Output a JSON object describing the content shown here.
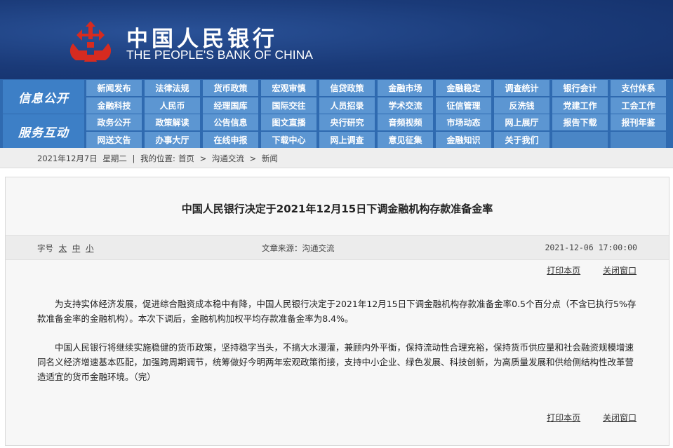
{
  "header": {
    "cn_name": "中国人民银行",
    "en_name": "THE PEOPLE'S BANK OF CHINA",
    "logo_icon": "pboc-emblem-icon",
    "colors": {
      "header_bg": "#1c3d7d",
      "logo_red": "#d62b20"
    }
  },
  "nav": {
    "groups": [
      {
        "title": "信息公开",
        "rows": [
          [
            "新闻发布",
            "法律法规",
            "货币政策",
            "宏观审慎",
            "信贷政策",
            "金融市场",
            "金融稳定",
            "调查统计",
            "银行会计",
            "支付体系"
          ],
          [
            "金融科技",
            "人民币",
            "经理国库",
            "国际交往",
            "人员招录",
            "学术交流",
            "征信管理",
            "反洗钱",
            "党建工作",
            "工会工作"
          ]
        ]
      },
      {
        "title": "服务互动",
        "rows": [
          [
            "政务公开",
            "政策解读",
            "公告信息",
            "图文直播",
            "央行研究",
            "音频视频",
            "市场动态",
            "网上展厅",
            "报告下载",
            "报刊年鉴"
          ],
          [
            "网送文告",
            "办事大厅",
            "在线申报",
            "下载中心",
            "网上调查",
            "意见征集",
            "金融知识",
            "关于我们",
            "",
            ""
          ]
        ]
      }
    ],
    "colors": {
      "nav_bg": "#2f6ab0",
      "cell_bg": "#5c96d2"
    }
  },
  "breadcrumb": {
    "date": "2021年12月7日",
    "weekday": "星期二",
    "sep": "|",
    "location_label": "我的位置:",
    "items": [
      "首页",
      "沟通交流",
      "新闻"
    ],
    "arrow": ">"
  },
  "article": {
    "title": "中国人民银行决定于2021年12月15日下调金融机构存款准备金率",
    "font_size_label": "字号",
    "font_sizes": [
      "太",
      "中",
      "小"
    ],
    "source": "文章来源：沟通交流",
    "datetime": "2021-12-06 17:00:00",
    "print_label": "打印本页",
    "close_label": "关闭窗口",
    "paragraphs": [
      "为支持实体经济发展，促进综合融资成本稳中有降，中国人民银行决定于2021年12月15日下调金融机构存款准备金率0.5个百分点（不含已执行5%存款准备金率的金融机构）。本次下调后，金融机构加权平均存款准备金率为8.4%。",
      "中国人民银行将继续实施稳健的货币政策，坚持稳字当头，不搞大水漫灌，兼顾内外平衡，保持流动性合理充裕，保持货币供应量和社会融资规模增速同名义经济增速基本匹配，加强跨周期调节，统筹做好今明两年宏观政策衔接，支持中小企业、绿色发展、科技创新，为高质量发展和供给侧结构性改革营造适宜的货币金融环境。（完）"
    ]
  }
}
